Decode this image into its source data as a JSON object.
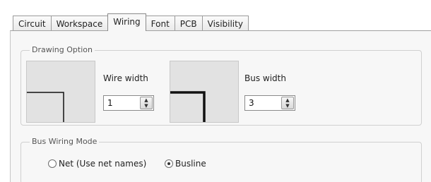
{
  "tabs": [
    {
      "label": "Circuit"
    },
    {
      "label": "Workspace"
    },
    {
      "label": "Wiring"
    },
    {
      "label": "Font"
    },
    {
      "label": "PCB"
    },
    {
      "label": "Visibility"
    }
  ],
  "active_tab": "Wiring",
  "drawing_option": {
    "title": "Drawing Option",
    "wire_width": {
      "label": "Wire width",
      "value": "1"
    },
    "bus_width": {
      "label": "Bus width",
      "value": "3"
    }
  },
  "bus_wiring_mode": {
    "title": "Bus Wiring Mode",
    "options": [
      {
        "label": "Net (Use net names)",
        "checked": false
      },
      {
        "label": "Busline",
        "checked": true
      }
    ]
  }
}
